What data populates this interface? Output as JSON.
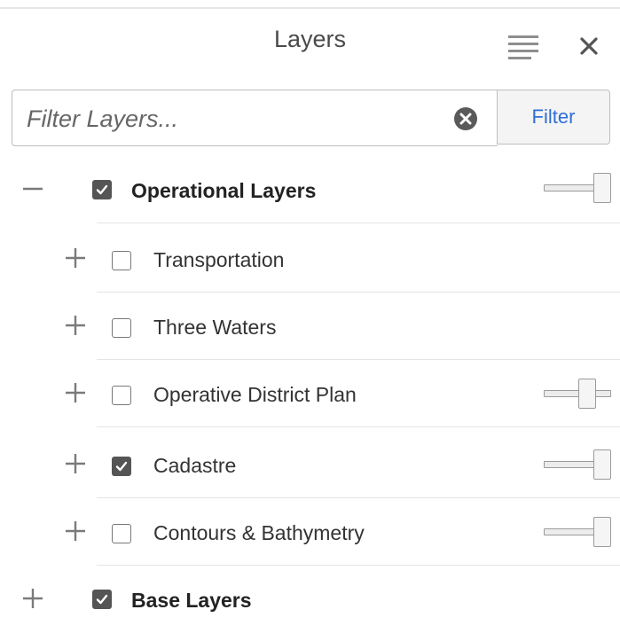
{
  "header": {
    "title": "Layers"
  },
  "filter": {
    "placeholder": "Filter Layers...",
    "value": "",
    "button_label": "Filter"
  },
  "layers": [
    {
      "label": "Operational Layers",
      "expander": "minus",
      "checked": true,
      "opacity": 1.0,
      "level": 0
    },
    {
      "label": "Transportation",
      "expander": "plus",
      "checked": false,
      "level": 1
    },
    {
      "label": "Three Waters",
      "expander": "plus",
      "checked": false,
      "level": 1
    },
    {
      "label": "Operative District Plan",
      "expander": "plus",
      "checked": false,
      "opacity": 0.7,
      "level": 1
    },
    {
      "label": "Cadastre",
      "expander": "plus",
      "checked": true,
      "opacity": 1.0,
      "level": 1
    },
    {
      "label": "Contours & Bathymetry",
      "expander": "plus",
      "checked": false,
      "opacity": 1.0,
      "level": 1
    },
    {
      "label": "Base Layers",
      "expander": "plus",
      "checked": true,
      "level": 0
    }
  ],
  "icons": {
    "menu": "hamburger-list-icon",
    "close": "close-icon",
    "clear": "clear-circle-x-icon",
    "expand": "plus-icon",
    "collapse": "minus-icon",
    "checkbox": "checkmark-icon"
  },
  "colors": {
    "accent": "#2e6fd6",
    "checkbox_checked": "#555555",
    "divider": "#e4e4e4"
  }
}
